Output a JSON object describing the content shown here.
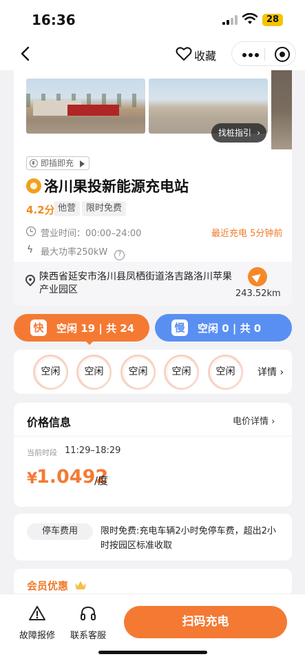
{
  "status_bar": {
    "time": "16:36",
    "battery": "28"
  },
  "nav": {
    "favorite_label": "收藏"
  },
  "station": {
    "find_pile_label": "找桩指引",
    "plug_tag": "即插即充",
    "name": "洛川果投新能源充电站",
    "rating": "4.2分",
    "tags": [
      "他营",
      "限时免费"
    ],
    "hours": "营业时间：00:00–24:00",
    "recent_charge": "最近充电 5分钟前",
    "max_power": "最大功率250kW",
    "address": "陕西省延安市洛川县凤栖街道洛吉路洛川苹果产业园区",
    "distance": "243.52km"
  },
  "chargers": {
    "fast": {
      "badge": "快",
      "status": "空闲 19 | 共 24"
    },
    "slow": {
      "badge": "慢",
      "status": "空闲 0 | 共 0"
    },
    "connectors": [
      "空闲",
      "空闲",
      "空闲",
      "空闲",
      "空闲"
    ],
    "details_label": "详情"
  },
  "price": {
    "title": "价格信息",
    "details_label": "电价详情",
    "period_label": "当前时段",
    "period_value": "11:29–18:29",
    "currency": "¥",
    "value": "1.0492",
    "unit": "/度"
  },
  "parking": {
    "label": "停车费用",
    "text": "限时免费:充电车辆2小时免停车费，超出2小时按园区标准收取"
  },
  "member": {
    "title": "会员优惠"
  },
  "bottom": {
    "report_label": "故障报修",
    "service_label": "联系客服",
    "scan_label": "扫码充电"
  },
  "colors": {
    "accent_orange": "#f47a34",
    "slow_blue": "#5a8ff2"
  }
}
